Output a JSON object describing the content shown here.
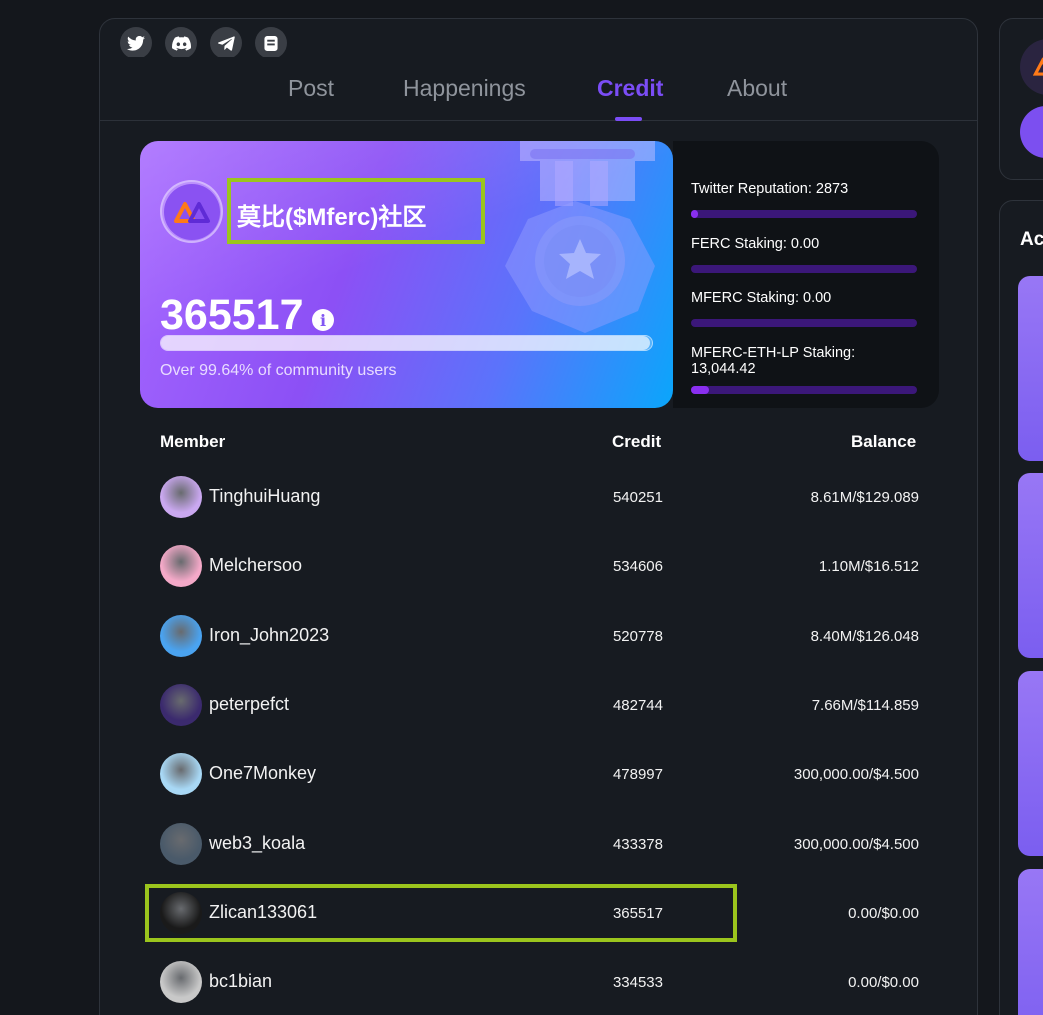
{
  "social_icons": [
    "twitter-icon",
    "discord-icon",
    "telegram-icon",
    "docs-icon"
  ],
  "tabs": [
    {
      "label": "Post",
      "active": false
    },
    {
      "label": "Happenings",
      "active": false
    },
    {
      "label": "Credit",
      "active": true
    },
    {
      "label": "About",
      "active": false
    }
  ],
  "hero": {
    "community_name": "莫比($Mferc)社区",
    "credit": "365517",
    "info_icon_label": "i",
    "percentile_text": "Over 99.64% of community users",
    "progress_fraction": 0.9964
  },
  "stats": [
    {
      "label": "Twitter Reputation: 2873",
      "fill": 0.03
    },
    {
      "label": "FERC Staking: 0.00",
      "fill": 0.0
    },
    {
      "label": "MFERC Staking: 0.00",
      "fill": 0.0
    },
    {
      "label": "MFERC-ETH-LP Staking: 13,044.42",
      "fill": 0.08
    }
  ],
  "table": {
    "headers": {
      "member": "Member",
      "credit": "Credit",
      "balance": "Balance"
    },
    "rows": [
      {
        "name": "TinghuiHuang",
        "credit": "540251",
        "balance": "8.61M/$129.089",
        "avatar_bg": "#caa8f0"
      },
      {
        "name": "Melchersoo",
        "credit": "534606",
        "balance": "1.10M/$16.512",
        "avatar_bg": "#f4a9c8"
      },
      {
        "name": "Iron_John2023",
        "credit": "520778",
        "balance": "8.40M/$126.048",
        "avatar_bg": "#4aa3f0"
      },
      {
        "name": "peterpefct",
        "credit": "482744",
        "balance": "7.66M/$114.859",
        "avatar_bg": "#3b2a6e"
      },
      {
        "name": "One7Monkey",
        "credit": "478997",
        "balance": "300,000.00/$4.500",
        "avatar_bg": "#a8d8f5"
      },
      {
        "name": "web3_koala",
        "credit": "433378",
        "balance": "300,000.00/$4.500",
        "avatar_bg": "#4a5a6a"
      },
      {
        "name": "Zlican133061",
        "credit": "365517",
        "balance": "0.00/$0.00",
        "avatar_bg": "#1a1a1a"
      },
      {
        "name": "bc1bian",
        "credit": "334533",
        "balance": "0.00/$0.00",
        "avatar_bg": "#c8c8c8"
      }
    ]
  },
  "sidebar": {
    "title_fragment": "Ac"
  },
  "colors": {
    "accent": "#7b4df6",
    "highlight": "#9bc51d",
    "background": "#14171c"
  }
}
